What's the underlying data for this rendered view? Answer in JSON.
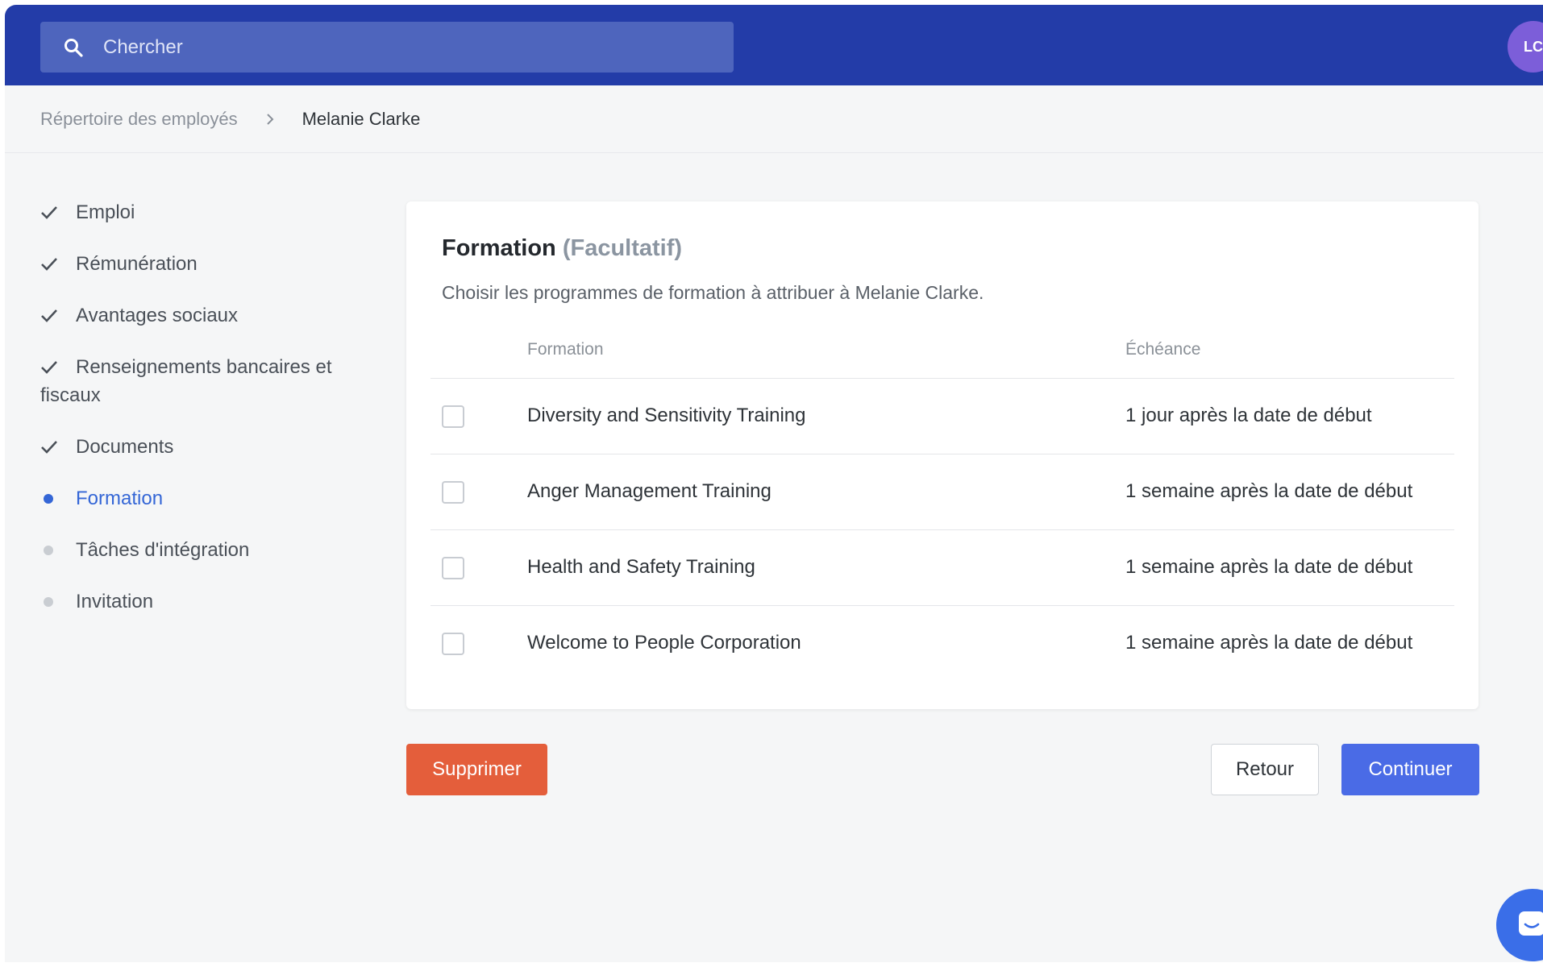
{
  "search": {
    "placeholder": "Chercher"
  },
  "user": {
    "initials": "LC"
  },
  "breadcrumb": {
    "parent": "Répertoire des employés",
    "current": "Melanie Clarke"
  },
  "steps": [
    {
      "label": "Emploi",
      "status": "done"
    },
    {
      "label": "Rémunération",
      "status": "done"
    },
    {
      "label": "Avantages sociaux",
      "status": "done"
    },
    {
      "label": "Renseignements bancaires et fiscaux",
      "status": "done"
    },
    {
      "label": "Documents",
      "status": "done"
    },
    {
      "label": "Formation",
      "status": "current"
    },
    {
      "label": "Tâches d'intégration",
      "status": "pending"
    },
    {
      "label": "Invitation",
      "status": "pending"
    }
  ],
  "card": {
    "title": "Formation",
    "optional": "(Facultatif)",
    "description": "Choisir les programmes de formation à attribuer à Melanie Clarke.",
    "columns": {
      "training": "Formation",
      "due": "Échéance"
    },
    "rows": [
      {
        "name": "Diversity and Sensitivity Training",
        "due": "1 jour après la date de début",
        "checked": false
      },
      {
        "name": "Anger Management Training",
        "due": "1 semaine après la date de début",
        "checked": false
      },
      {
        "name": "Health and Safety Training",
        "due": "1 semaine après la date de début",
        "checked": false
      },
      {
        "name": "Welcome to People Corporation",
        "due": "1 semaine après la date de début",
        "checked": false
      }
    ]
  },
  "buttons": {
    "delete": "Supprimer",
    "back": "Retour",
    "continue": "Continuer"
  },
  "colors": {
    "topbar": "#233ca8",
    "accent": "#3466d6",
    "danger": "#e45e3b",
    "primary": "#4a6be6"
  },
  "icons": {
    "search": "search-icon",
    "chevron": "chevron-right-icon",
    "check": "check-icon",
    "chat": "chat-icon"
  }
}
